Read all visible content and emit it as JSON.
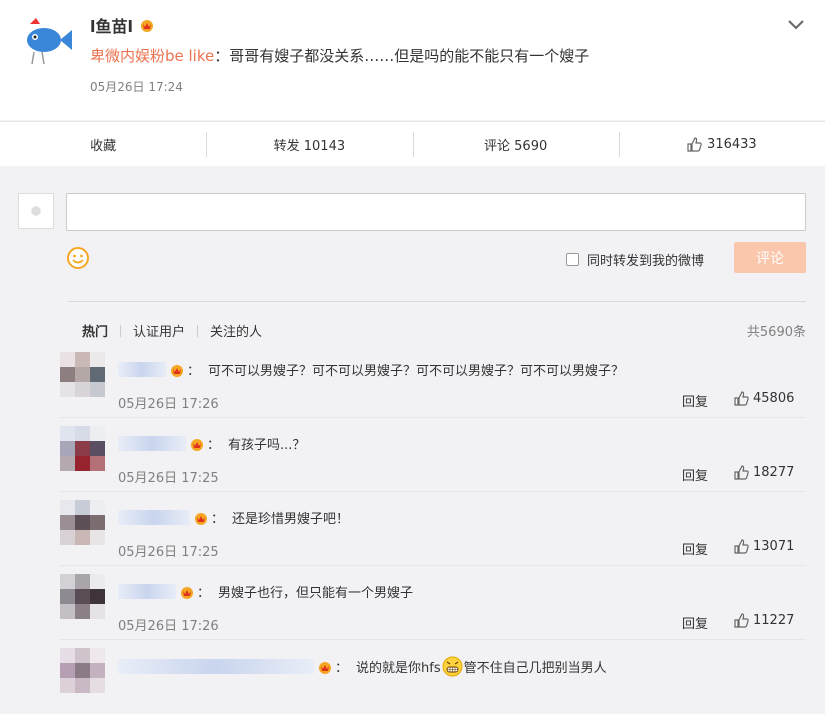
{
  "post": {
    "author": "l鱼苗l",
    "mention": "卑微内娱粉be like",
    "text": "：哥哥有嫂子都没关系……但是吗的能不能只有一个嫂子",
    "time": "05月26日 17:24"
  },
  "actions": {
    "favorite": "收藏",
    "repost": "转发 10143",
    "comment": "评论 5690",
    "like": "316433"
  },
  "composer": {
    "repost_label": "同时转发到我的微博",
    "submit_label": "评论"
  },
  "tabs": [
    "热门",
    "认证用户",
    "关注的人"
  ],
  "total": "共5690条",
  "reply_label": "回复",
  "comments": [
    {
      "text": "可不可以男嫂子？可不可以男嫂子？可不可以男嫂子？可不可以男嫂子？",
      "time": "05月26日 17:26",
      "likes": "45806"
    },
    {
      "text": "有孩子吗...？",
      "time": "05月26日 17:25",
      "likes": "18277"
    },
    {
      "text": "还是珍惜男嫂子吧！",
      "time": "05月26日 17:25",
      "likes": "13071"
    },
    {
      "text": "男嫂子也行，但只能有一个男嫂子",
      "time": "05月26日 17:26",
      "likes": "11227"
    },
    {
      "text_before": "说的就是你hfs",
      "text_after": "管不住自己几把别当男人"
    }
  ],
  "colors": {
    "mention": "#eb7350",
    "submit_bg": "#fbc7ac"
  }
}
